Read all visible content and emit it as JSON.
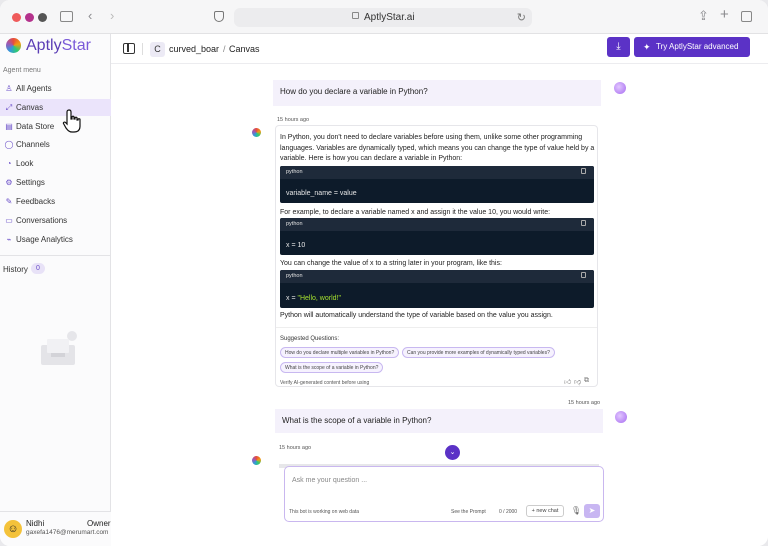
{
  "browser": {
    "url": "AptlyStar.ai"
  },
  "sidebar": {
    "brand_prefix": "Aptly",
    "brand_suffix": "Star",
    "section_label": "Agent menu",
    "items": [
      {
        "label": "All Agents",
        "icon": "agents-icon"
      },
      {
        "label": "Canvas",
        "icon": "canvas-icon"
      },
      {
        "label": "Data Store",
        "icon": "datastore-icon"
      },
      {
        "label": "Channels",
        "icon": "channels-icon"
      },
      {
        "label": "Look",
        "icon": "look-icon"
      },
      {
        "label": "Settings",
        "icon": "gear-icon"
      },
      {
        "label": "Feedbacks",
        "icon": "feedback-icon"
      },
      {
        "label": "Conversations",
        "icon": "chat-icon"
      },
      {
        "label": "Usage Analytics",
        "icon": "analytics-icon"
      }
    ],
    "history_label": "History",
    "history_count": "0",
    "user": {
      "name": "Nidhi",
      "role": "Owner",
      "email": "gaxefa1476@merumart.com"
    }
  },
  "topbar": {
    "badge": "C",
    "agent": "curved_boar",
    "separator": "/",
    "page": "Canvas",
    "try_label": "Try AptlyStar advanced"
  },
  "chat": {
    "q1": "How do you declare a variable in Python?",
    "ts1": "15 hours ago",
    "a1": {
      "intro": "In Python, you don't need to declare variables before using them, unlike some other programming languages. Variables are dynamically typed, which means you can change the type of value held by a variable. Here is how you can declare a variable in Python:",
      "code1_lang": "python",
      "code1": "variable_name = value",
      "p2": "For example, to declare a variable named x and assign it the value 10, you would write:",
      "code2_lang": "python",
      "code2": "x = 10",
      "p3": "You can change the value of x to a string later in your program, like this:",
      "code3_lang": "python",
      "code3_var": "x = ",
      "code3_str": "\"Hello, world!\"",
      "p4": "Python will automatically understand the type of variable based on the value you assign.",
      "suggested_label": "Suggested Questions:",
      "suggestions": [
        "How do you declare multiple variables in Python?",
        "Can you provide more examples of dynamically typed variables?",
        "What is the scope of a variable in Python?"
      ],
      "verify": "Verify AI-generated content before using"
    },
    "ts2": "15 hours ago",
    "q2": "What is the scope of a variable in Python?",
    "ts3": "15 hours ago",
    "input": {
      "placeholder": "Ask me your question ...",
      "hint": "This bot is working on web data",
      "see_prompt": "See the Prompt",
      "count": "0 / 2000",
      "new_chat": "+ new chat"
    }
  }
}
